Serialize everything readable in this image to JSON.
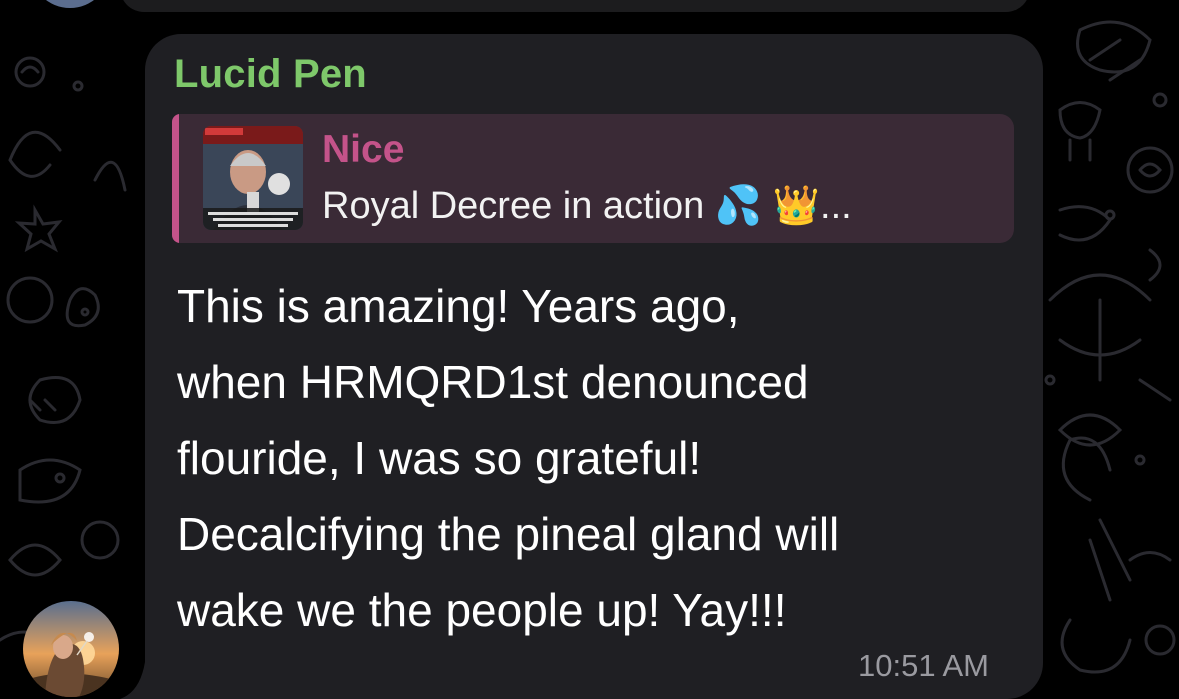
{
  "message": {
    "sender": "Lucid Pen",
    "reply": {
      "author": "Nice",
      "preview_text": "Royal Decree in action 💦 👑...",
      "thumbnail_icon": "news-thumbnail-image",
      "thumbnail_caption_top": "BREAKING NEWS",
      "thumbnail_caption_bottom": "RFK JR. REPLACES FLUORIDE WITH CREATINE IN PUBLIC WATER (NOW IN EVERY"
    },
    "text": "This is amazing!   Years ago,\nwhen HRMQRD1st denounced\nflouride, I was so grateful!\nDecalcifying the pineal gland will\nwake we the people up!   Yay!!!",
    "time": "10:51 AM"
  },
  "colors": {
    "background": "#000000",
    "bubble": "#1f1f23",
    "sender_name": "#7ec86a",
    "reply_accent": "#c4538a",
    "reply_bg": "#3a2a36",
    "timestamp": "#9a9aa0"
  }
}
